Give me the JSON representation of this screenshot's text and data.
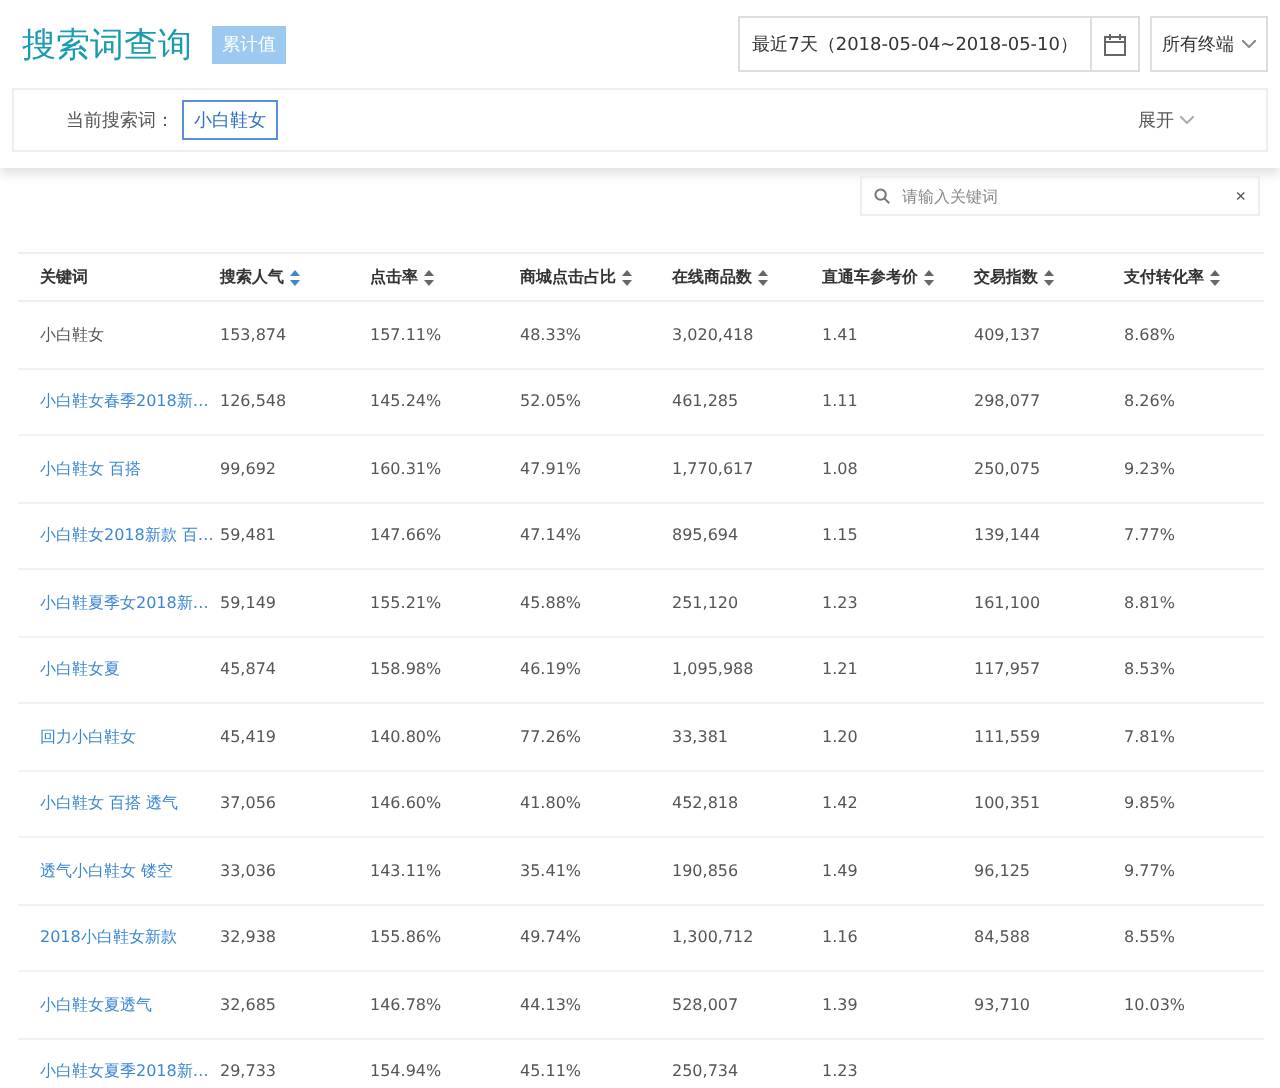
{
  "header": {
    "title": "搜索词查询",
    "badge": "累计值",
    "date_range": "最近7天（2018-05-04~2018-05-10）",
    "device_filter": "所有终端"
  },
  "filter": {
    "label": "当前搜索词：",
    "tags": [
      {
        "label": "小白鞋女",
        "selected": true
      }
    ],
    "expand": "展开"
  },
  "search": {
    "placeholder": "请输入关键词",
    "clear": "×"
  },
  "table": {
    "columns": [
      {
        "label": "关键词"
      },
      {
        "label": "搜索人气",
        "sorted": true
      },
      {
        "label": "点击率",
        "sorted": false
      },
      {
        "label": "商城点击占比",
        "sorted": false
      },
      {
        "label": "在线商品数",
        "sorted": false
      },
      {
        "label": "直通车参考价",
        "sorted": false
      },
      {
        "label": "交易指数",
        "sorted": false
      },
      {
        "label": "支付转化率",
        "sorted": false
      }
    ],
    "rows": [
      {
        "link": false,
        "cells": [
          "小白鞋女",
          "153,874",
          "157.11%",
          "48.33%",
          "3,020,418",
          "1.41",
          "409,137",
          "8.68%"
        ]
      },
      {
        "link": true,
        "cells": [
          "小白鞋女春季2018新…",
          "126,548",
          "145.24%",
          "52.05%",
          "461,285",
          "1.11",
          "298,077",
          "8.26%"
        ]
      },
      {
        "link": true,
        "cells": [
          "小白鞋女 百搭",
          "99,692",
          "160.31%",
          "47.91%",
          "1,770,617",
          "1.08",
          "250,075",
          "9.23%"
        ]
      },
      {
        "link": true,
        "cells": [
          "小白鞋女2018新款 百…",
          "59,481",
          "147.66%",
          "47.14%",
          "895,694",
          "1.15",
          "139,144",
          "7.77%"
        ]
      },
      {
        "link": true,
        "cells": [
          "小白鞋夏季女2018新…",
          "59,149",
          "155.21%",
          "45.88%",
          "251,120",
          "1.23",
          "161,100",
          "8.81%"
        ]
      },
      {
        "link": true,
        "cells": [
          "小白鞋女夏",
          "45,874",
          "158.98%",
          "46.19%",
          "1,095,988",
          "1.21",
          "117,957",
          "8.53%"
        ]
      },
      {
        "link": true,
        "cells": [
          "回力小白鞋女",
          "45,419",
          "140.80%",
          "77.26%",
          "33,381",
          "1.20",
          "111,559",
          "7.81%"
        ]
      },
      {
        "link": true,
        "cells": [
          "小白鞋女 百搭 透气",
          "37,056",
          "146.60%",
          "41.80%",
          "452,818",
          "1.42",
          "100,351",
          "9.85%"
        ]
      },
      {
        "link": true,
        "cells": [
          "透气小白鞋女 镂空",
          "33,036",
          "143.11%",
          "35.41%",
          "190,856",
          "1.49",
          "96,125",
          "9.77%"
        ]
      },
      {
        "link": true,
        "cells": [
          "2018小白鞋女新款",
          "32,938",
          "155.86%",
          "49.74%",
          "1,300,712",
          "1.16",
          "84,588",
          "8.55%"
        ]
      },
      {
        "link": true,
        "cells": [
          "小白鞋女夏透气",
          "32,685",
          "146.78%",
          "44.13%",
          "528,007",
          "1.39",
          "93,710",
          "10.03%"
        ]
      },
      {
        "link": true,
        "cells": [
          "小白鞋女夏季2018新…",
          "29,733",
          "154.94%",
          "45.11%",
          "250,734",
          "1.23"
        ]
      }
    ]
  }
}
